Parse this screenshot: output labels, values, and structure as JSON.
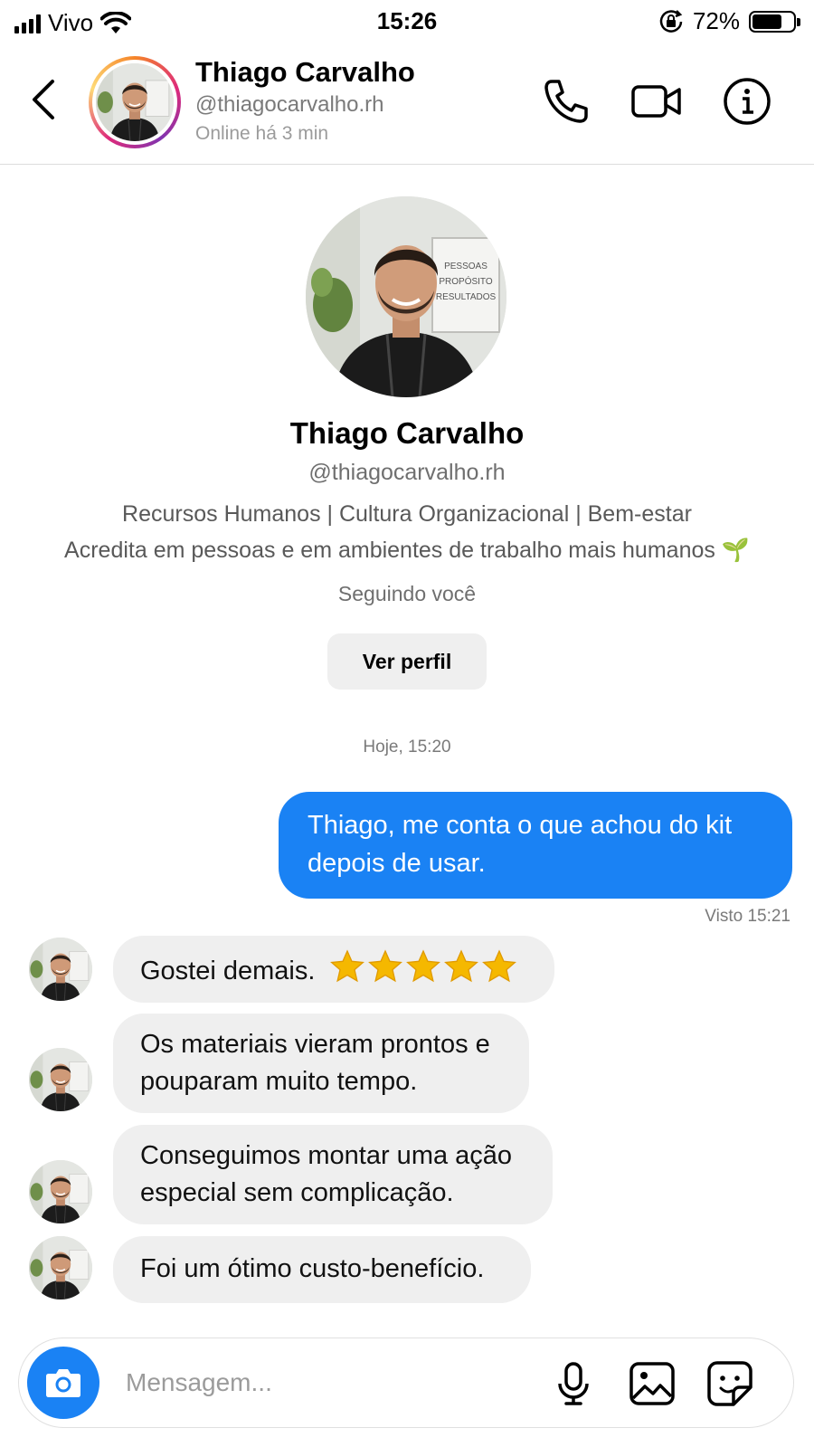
{
  "status_bar": {
    "carrier": "Vivo",
    "time": "15:26",
    "battery_percent": "72%",
    "battery_level": 0.72
  },
  "header": {
    "name": "Thiago Carvalho",
    "handle": "@thiagocarvalho.rh",
    "status": "Online há 3 min"
  },
  "profile": {
    "name": "Thiago Carvalho",
    "handle": "@thiagocarvalho.rh",
    "bio_line1": "Recursos Humanos | Cultura Organizacional | Bem-estar",
    "bio_line2": "Acredita em pessoas e em ambientes de trabalho mais humanos 🌱",
    "following": "Seguindo você",
    "view_profile_label": "Ver perfil",
    "photo_sign": [
      "PESSOAS",
      "PROPÓSITO",
      "RESULTADOS"
    ]
  },
  "chat": {
    "date_label": "Hoje, 15:20",
    "outgoing": {
      "text": "Thiago, me conta o que achou do kit depois de usar.",
      "seen": "Visto 15:21"
    },
    "incoming": [
      {
        "text": "Gostei demais.",
        "stars": 5
      },
      {
        "text": "Os materiais vieram prontos e pouparam muito tempo."
      },
      {
        "text": "Conseguimos montar uma ação especial sem complicação."
      },
      {
        "text": "Foi um ótimo custo-benefício."
      }
    ]
  },
  "composer": {
    "placeholder": "Mensagem..."
  },
  "colors": {
    "accent": "#1a82f4",
    "bubble_in": "#efefef",
    "star": "#f5b800"
  },
  "icons": [
    "back-icon",
    "phone-icon",
    "video-icon",
    "info-icon",
    "camera-icon",
    "microphone-icon",
    "gallery-icon",
    "sticker-icon",
    "star-icon",
    "plant-emoji"
  ]
}
